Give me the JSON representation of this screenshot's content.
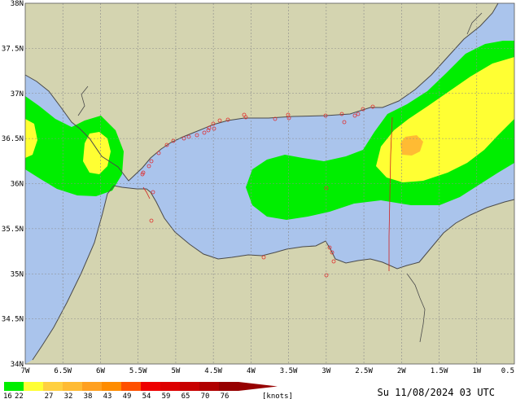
{
  "map": {
    "lon_range": [
      -7,
      -0.5
    ],
    "lat_range": [
      34,
      38
    ],
    "lon_ticks": [
      "7W",
      "6.5W",
      "6W",
      "5.5W",
      "5W",
      "4.5W",
      "4W",
      "3.5W",
      "3W",
      "2.5W",
      "2W",
      "1.5W",
      "1W",
      "0.5"
    ],
    "lat_ticks": [
      "38N",
      "37.5N",
      "37N",
      "36.5N",
      "36N",
      "35.5N",
      "35N",
      "34.5N",
      "34N"
    ],
    "colors": {
      "land": "#d4d4b0",
      "sea": "#aac4ec",
      "grid": "#8a8a8a",
      "coast": "#4a4a4a",
      "border": "#d02020",
      "wind_16_22": "#00ee00",
      "wind_22_27": "#ffff33",
      "wind_27_32": "#ffbb33"
    }
  },
  "legend": {
    "unit": "[knots]",
    "labels": [
      "16",
      "22",
      "27",
      "32",
      "38",
      "43",
      "49",
      "54",
      "59",
      "65",
      "70",
      "76"
    ],
    "colors": [
      "#00ee00",
      "#ffff33",
      "#ffd040",
      "#ffbb33",
      "#ffa020",
      "#ff8c00",
      "#ff5000",
      "#ee0000",
      "#dd0000",
      "#c80000",
      "#b00000",
      "#960000"
    ]
  },
  "timestamp": "Su 11/08/2024 03 UTC"
}
